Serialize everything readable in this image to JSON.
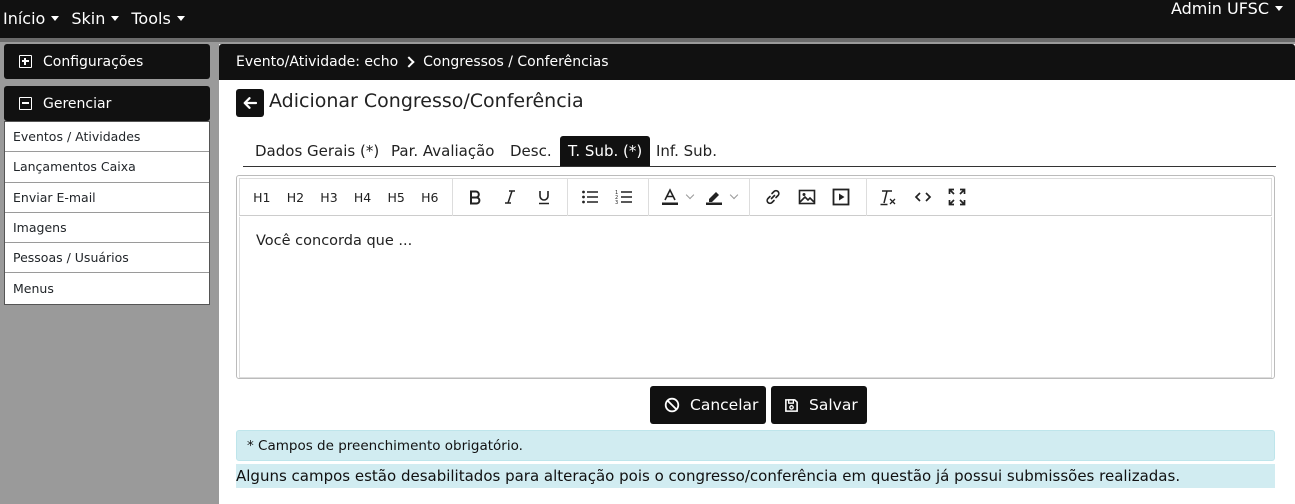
{
  "topnav": {
    "items": [
      "Início",
      "Skin",
      "Tools"
    ],
    "user": "Admin UFSC"
  },
  "sidebar": {
    "config_label": "Configurações",
    "manage_label": "Gerenciar",
    "items": [
      "Eventos / Atividades",
      "Lançamentos Caixa",
      "Enviar E-mail",
      "Imagens",
      "Pessoas / Usuários",
      "Menus"
    ]
  },
  "breadcrumb": {
    "first": "Evento/Atividade: echo",
    "second": "Congressos / Conferências"
  },
  "page": {
    "title": "Adicionar Congresso/Conferência"
  },
  "tabs": [
    "Dados Gerais (*)",
    "Par. Avaliação",
    "Desc.",
    "T. Sub. (*)",
    "Inf. Sub."
  ],
  "active_tab": "T. Sub. (*)",
  "editor": {
    "headings": [
      "H1",
      "H2",
      "H3",
      "H4",
      "H5",
      "H6"
    ],
    "content": "Você concorda que ..."
  },
  "buttons": {
    "cancel": "Cancelar",
    "save": "Salvar"
  },
  "alerts": {
    "required": "* Campos de preenchimento obrigatório.",
    "disabled": "Alguns campos estão desabilitados para alteração pois o congresso/conferência em questão já possui submissões realizadas."
  }
}
